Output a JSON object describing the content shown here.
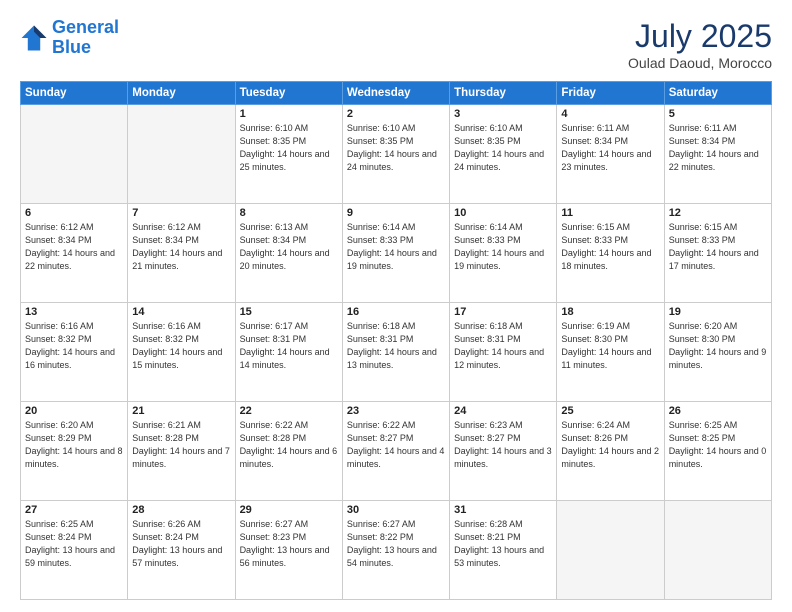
{
  "header": {
    "logo_line1": "General",
    "logo_line2": "Blue",
    "month": "July 2025",
    "location": "Oulad Daoud, Morocco"
  },
  "days_of_week": [
    "Sunday",
    "Monday",
    "Tuesday",
    "Wednesday",
    "Thursday",
    "Friday",
    "Saturday"
  ],
  "weeks": [
    [
      {
        "day": "",
        "empty": true
      },
      {
        "day": "",
        "empty": true
      },
      {
        "day": "1",
        "sunrise": "6:10 AM",
        "sunset": "8:35 PM",
        "daylight": "14 hours and 25 minutes."
      },
      {
        "day": "2",
        "sunrise": "6:10 AM",
        "sunset": "8:35 PM",
        "daylight": "14 hours and 24 minutes."
      },
      {
        "day": "3",
        "sunrise": "6:10 AM",
        "sunset": "8:35 PM",
        "daylight": "14 hours and 24 minutes."
      },
      {
        "day": "4",
        "sunrise": "6:11 AM",
        "sunset": "8:34 PM",
        "daylight": "14 hours and 23 minutes."
      },
      {
        "day": "5",
        "sunrise": "6:11 AM",
        "sunset": "8:34 PM",
        "daylight": "14 hours and 22 minutes."
      }
    ],
    [
      {
        "day": "6",
        "sunrise": "6:12 AM",
        "sunset": "8:34 PM",
        "daylight": "14 hours and 22 minutes."
      },
      {
        "day": "7",
        "sunrise": "6:12 AM",
        "sunset": "8:34 PM",
        "daylight": "14 hours and 21 minutes."
      },
      {
        "day": "8",
        "sunrise": "6:13 AM",
        "sunset": "8:34 PM",
        "daylight": "14 hours and 20 minutes."
      },
      {
        "day": "9",
        "sunrise": "6:14 AM",
        "sunset": "8:33 PM",
        "daylight": "14 hours and 19 minutes."
      },
      {
        "day": "10",
        "sunrise": "6:14 AM",
        "sunset": "8:33 PM",
        "daylight": "14 hours and 19 minutes."
      },
      {
        "day": "11",
        "sunrise": "6:15 AM",
        "sunset": "8:33 PM",
        "daylight": "14 hours and 18 minutes."
      },
      {
        "day": "12",
        "sunrise": "6:15 AM",
        "sunset": "8:33 PM",
        "daylight": "14 hours and 17 minutes."
      }
    ],
    [
      {
        "day": "13",
        "sunrise": "6:16 AM",
        "sunset": "8:32 PM",
        "daylight": "14 hours and 16 minutes."
      },
      {
        "day": "14",
        "sunrise": "6:16 AM",
        "sunset": "8:32 PM",
        "daylight": "14 hours and 15 minutes."
      },
      {
        "day": "15",
        "sunrise": "6:17 AM",
        "sunset": "8:31 PM",
        "daylight": "14 hours and 14 minutes."
      },
      {
        "day": "16",
        "sunrise": "6:18 AM",
        "sunset": "8:31 PM",
        "daylight": "14 hours and 13 minutes."
      },
      {
        "day": "17",
        "sunrise": "6:18 AM",
        "sunset": "8:31 PM",
        "daylight": "14 hours and 12 minutes."
      },
      {
        "day": "18",
        "sunrise": "6:19 AM",
        "sunset": "8:30 PM",
        "daylight": "14 hours and 11 minutes."
      },
      {
        "day": "19",
        "sunrise": "6:20 AM",
        "sunset": "8:30 PM",
        "daylight": "14 hours and 9 minutes."
      }
    ],
    [
      {
        "day": "20",
        "sunrise": "6:20 AM",
        "sunset": "8:29 PM",
        "daylight": "14 hours and 8 minutes."
      },
      {
        "day": "21",
        "sunrise": "6:21 AM",
        "sunset": "8:28 PM",
        "daylight": "14 hours and 7 minutes."
      },
      {
        "day": "22",
        "sunrise": "6:22 AM",
        "sunset": "8:28 PM",
        "daylight": "14 hours and 6 minutes."
      },
      {
        "day": "23",
        "sunrise": "6:22 AM",
        "sunset": "8:27 PM",
        "daylight": "14 hours and 4 minutes."
      },
      {
        "day": "24",
        "sunrise": "6:23 AM",
        "sunset": "8:27 PM",
        "daylight": "14 hours and 3 minutes."
      },
      {
        "day": "25",
        "sunrise": "6:24 AM",
        "sunset": "8:26 PM",
        "daylight": "14 hours and 2 minutes."
      },
      {
        "day": "26",
        "sunrise": "6:25 AM",
        "sunset": "8:25 PM",
        "daylight": "14 hours and 0 minutes."
      }
    ],
    [
      {
        "day": "27",
        "sunrise": "6:25 AM",
        "sunset": "8:24 PM",
        "daylight": "13 hours and 59 minutes."
      },
      {
        "day": "28",
        "sunrise": "6:26 AM",
        "sunset": "8:24 PM",
        "daylight": "13 hours and 57 minutes."
      },
      {
        "day": "29",
        "sunrise": "6:27 AM",
        "sunset": "8:23 PM",
        "daylight": "13 hours and 56 minutes."
      },
      {
        "day": "30",
        "sunrise": "6:27 AM",
        "sunset": "8:22 PM",
        "daylight": "13 hours and 54 minutes."
      },
      {
        "day": "31",
        "sunrise": "6:28 AM",
        "sunset": "8:21 PM",
        "daylight": "13 hours and 53 minutes."
      },
      {
        "day": "",
        "empty": true
      },
      {
        "day": "",
        "empty": true
      }
    ]
  ]
}
